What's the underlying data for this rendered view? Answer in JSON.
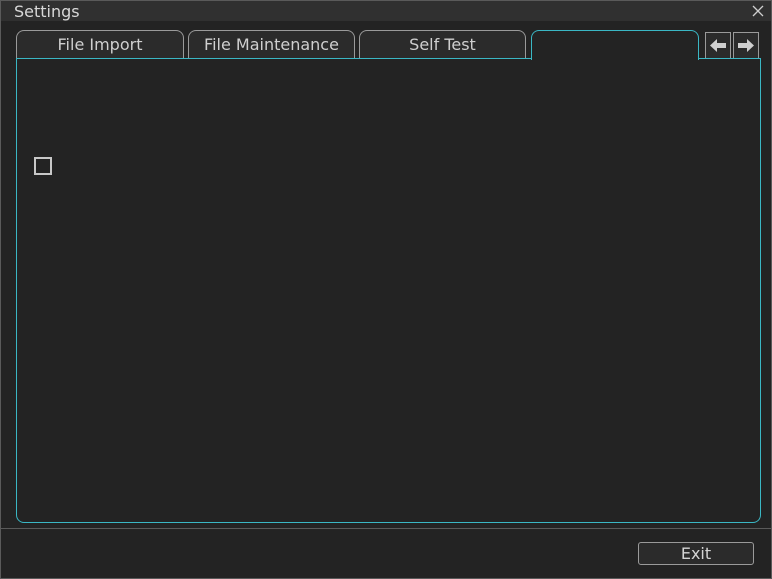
{
  "window": {
    "title": "Settings",
    "close_icon": "close-icon"
  },
  "tabs": [
    {
      "label": "File Import",
      "active": false
    },
    {
      "label": "File Maintenance",
      "active": false
    },
    {
      "label": "Self Test",
      "active": false
    },
    {
      "label": "",
      "active": true
    }
  ],
  "tab_nav": {
    "prev_icon": "arrow-left-icon",
    "next_icon": "arrow-right-icon"
  },
  "panel": {
    "checkbox": {
      "checked": false
    }
  },
  "footer": {
    "exit_label": "Exit"
  },
  "colors": {
    "accent": "#3ab7c4",
    "background": "#232323",
    "titlebar": "#303030",
    "border": "#9a9a9a",
    "text": "#d4d4d4"
  }
}
